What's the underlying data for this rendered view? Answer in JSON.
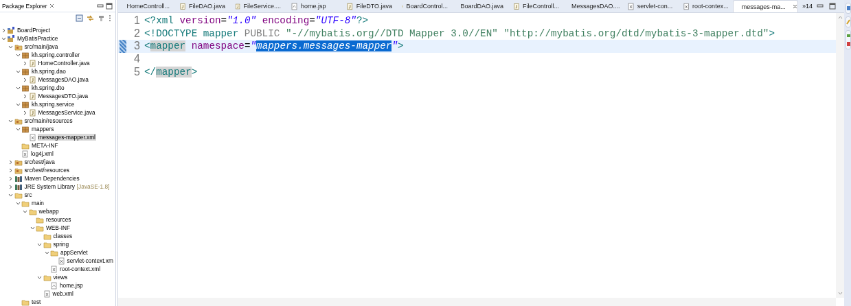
{
  "explorer": {
    "title": "Package Explorer",
    "tree": [
      {
        "label": "BoardProject",
        "kind": "project",
        "expanded": false,
        "selected": false
      },
      {
        "label": "MyBatisPractice",
        "kind": "project",
        "expanded": true,
        "selected": false,
        "children": [
          {
            "label": "src/main/java",
            "kind": "srcfolder",
            "expanded": true,
            "selected": false,
            "children": [
              {
                "label": "kh.spring.controller",
                "kind": "package",
                "expanded": true,
                "selected": false,
                "children": [
                  {
                    "label": "HomeController.java",
                    "kind": "java",
                    "expanded": false,
                    "selected": false
                  }
                ]
              },
              {
                "label": "kh.spring.dao",
                "kind": "package",
                "expanded": true,
                "selected": false,
                "children": [
                  {
                    "label": "MessagesDAO.java",
                    "kind": "java",
                    "expanded": false,
                    "selected": false
                  }
                ]
              },
              {
                "label": "kh.spring.dto",
                "kind": "package",
                "expanded": true,
                "selected": false,
                "children": [
                  {
                    "label": "MessagesDTO.java",
                    "kind": "java",
                    "expanded": false,
                    "selected": false
                  }
                ]
              },
              {
                "label": "kh.spring.service",
                "kind": "package",
                "expanded": true,
                "selected": false,
                "children": [
                  {
                    "label": "MessagesService.java",
                    "kind": "java",
                    "expanded": false,
                    "selected": false
                  }
                ]
              }
            ]
          },
          {
            "label": "src/main/resources",
            "kind": "srcfolder",
            "expanded": true,
            "selected": false,
            "children": [
              {
                "label": "mappers",
                "kind": "package",
                "expanded": true,
                "selected": false,
                "children": [
                  {
                    "label": "messages-mapper.xml",
                    "kind": "xml",
                    "selected": true
                  }
                ]
              },
              {
                "label": "META-INF",
                "kind": "folder",
                "selected": false
              },
              {
                "label": "log4j.xml",
                "kind": "xml",
                "selected": false
              }
            ]
          },
          {
            "label": "src/test/java",
            "kind": "srcfolder",
            "expanded": false,
            "selected": false
          },
          {
            "label": "src/test/resources",
            "kind": "srcfolder",
            "expanded": false,
            "selected": false
          },
          {
            "label": "Maven Dependencies",
            "kind": "library",
            "expanded": false,
            "selected": false
          },
          {
            "label": "JRE System Library",
            "decoration": "[JavaSE-1.8]",
            "kind": "library",
            "expanded": false,
            "selected": false
          },
          {
            "label": "src",
            "kind": "folder",
            "expanded": true,
            "selected": false,
            "children": [
              {
                "label": "main",
                "kind": "folder",
                "expanded": true,
                "selected": false,
                "children": [
                  {
                    "label": "webapp",
                    "kind": "folder",
                    "expanded": true,
                    "selected": false,
                    "children": [
                      {
                        "label": "resources",
                        "kind": "folder",
                        "selected": false
                      },
                      {
                        "label": "WEB-INF",
                        "kind": "folder",
                        "expanded": true,
                        "selected": false,
                        "children": [
                          {
                            "label": "classes",
                            "kind": "folder",
                            "selected": false
                          },
                          {
                            "label": "spring",
                            "kind": "folder",
                            "expanded": true,
                            "selected": false,
                            "children": [
                              {
                                "label": "appServlet",
                                "kind": "folder",
                                "expanded": true,
                                "selected": false,
                                "children": [
                                  {
                                    "label": "servlet-context.xm",
                                    "kind": "xml",
                                    "selected": false
                                  }
                                ]
                              },
                              {
                                "label": "root-context.xml",
                                "kind": "xml",
                                "selected": false
                              }
                            ]
                          },
                          {
                            "label": "views",
                            "kind": "folder",
                            "expanded": true,
                            "selected": false,
                            "children": [
                              {
                                "label": "home.jsp",
                                "kind": "jsp",
                                "selected": false
                              }
                            ]
                          },
                          {
                            "label": "web.xml",
                            "kind": "xml",
                            "selected": false
                          }
                        ]
                      }
                    ]
                  }
                ]
              },
              {
                "label": "test",
                "kind": "folder",
                "selected": false
              }
            ]
          }
        ]
      }
    ]
  },
  "editor": {
    "tabs": [
      {
        "label": "HomeControll...",
        "kind": "java",
        "selected": false
      },
      {
        "label": "FileDAO.java",
        "kind": "java",
        "selected": false
      },
      {
        "label": "FileService....",
        "kind": "java",
        "selected": false
      },
      {
        "label": "home.jsp",
        "kind": "jsp",
        "selected": false
      },
      {
        "label": "FileDTO.java",
        "kind": "java",
        "selected": false
      },
      {
        "label": "BoardControl...",
        "kind": "java",
        "selected": false
      },
      {
        "label": "BoardDAO.java",
        "kind": "java",
        "selected": false
      },
      {
        "label": "FileControll...",
        "kind": "java",
        "selected": false
      },
      {
        "label": "MessagesDAO....",
        "kind": "java",
        "selected": false
      },
      {
        "label": "servlet-con...",
        "kind": "xml",
        "selected": false
      },
      {
        "label": "root-contex...",
        "kind": "xml",
        "selected": false
      },
      {
        "label": "messages-ma...",
        "kind": "xml",
        "selected": true
      }
    ],
    "overflow": "»14",
    "lines": [
      {
        "number": "1",
        "current": false,
        "tokens": [
          {
            "kind": "tag",
            "text": "<?xml "
          },
          {
            "kind": "attr",
            "text": "version"
          },
          {
            "kind": "plain",
            "text": "="
          },
          {
            "kind": "value",
            "text": "\"1.0\" "
          },
          {
            "kind": "attr",
            "text": "encoding"
          },
          {
            "kind": "plain",
            "text": "="
          },
          {
            "kind": "value",
            "text": "\"UTF-8\""
          },
          {
            "kind": "tag",
            "text": "?>"
          }
        ]
      },
      {
        "number": "2",
        "current": false,
        "tokens": [
          {
            "kind": "tag",
            "text": "<!DOCTYPE mapper "
          },
          {
            "kind": "keyword",
            "text": "PUBLIC "
          },
          {
            "kind": "string",
            "text": "\"-//mybatis.org//DTD Mapper 3.0//EN\" "
          },
          {
            "kind": "string",
            "text": "\"http://mybatis.org/dtd/mybatis-3-mapper.dtd\""
          },
          {
            "kind": "tag",
            "text": ">"
          }
        ]
      },
      {
        "number": "3",
        "current": true,
        "tokens": [
          {
            "kind": "tag",
            "text": "<"
          },
          {
            "kind": "tag-occurrence",
            "text": "mapper"
          },
          {
            "kind": "attr",
            "text": " namespace"
          },
          {
            "kind": "plain",
            "text": "="
          },
          {
            "kind": "value",
            "text": "\""
          },
          {
            "kind": "value-selected",
            "text": "mappers.messages-mapper"
          },
          {
            "kind": "value",
            "text": "\""
          },
          {
            "kind": "tag",
            "text": ">"
          }
        ]
      },
      {
        "number": "4",
        "current": false
      },
      {
        "number": "5",
        "current": false,
        "tokens": [
          {
            "kind": "tag",
            "text": "</"
          },
          {
            "kind": "tag-occurrence",
            "text": "mapper"
          },
          {
            "kind": "tag",
            "text": ">"
          }
        ]
      }
    ]
  }
}
